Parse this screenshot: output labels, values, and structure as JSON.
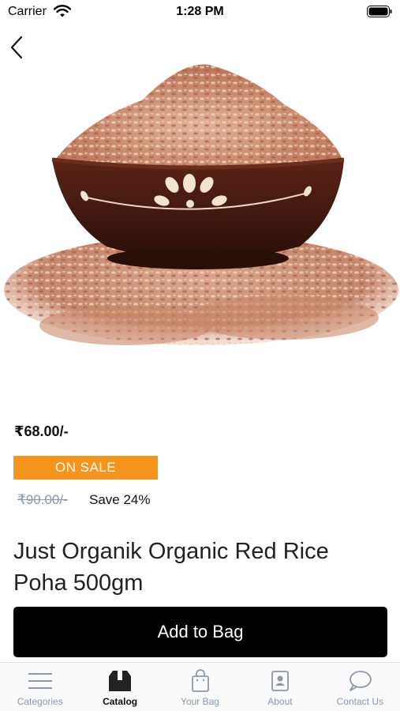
{
  "status_bar": {
    "carrier": "Carrier",
    "time": "1:28 PM"
  },
  "product": {
    "image_icon": "red-rice-poha-bowl",
    "price": "₹68.00/-",
    "badge": "ON SALE",
    "old_price": "₹90.00/-",
    "save": "Save 24%",
    "title": "Just Organik Organic Red Rice Poha 500gm"
  },
  "actions": {
    "add_to_bag": "Add to Bag"
  },
  "tab_bar": {
    "items": [
      {
        "label": "Categories",
        "icon": "menu-icon",
        "active": false
      },
      {
        "label": "Catalog",
        "icon": "box-icon",
        "active": true
      },
      {
        "label": "Your Bag",
        "icon": "shopping-bag-icon",
        "active": false
      },
      {
        "label": "About",
        "icon": "contact-card-icon",
        "active": false
      },
      {
        "label": "Contact Us",
        "icon": "chat-bubble-icon",
        "active": false
      }
    ]
  },
  "colors": {
    "accent": "#f7941d",
    "button": "#000000",
    "muted": "#8a98a8"
  }
}
